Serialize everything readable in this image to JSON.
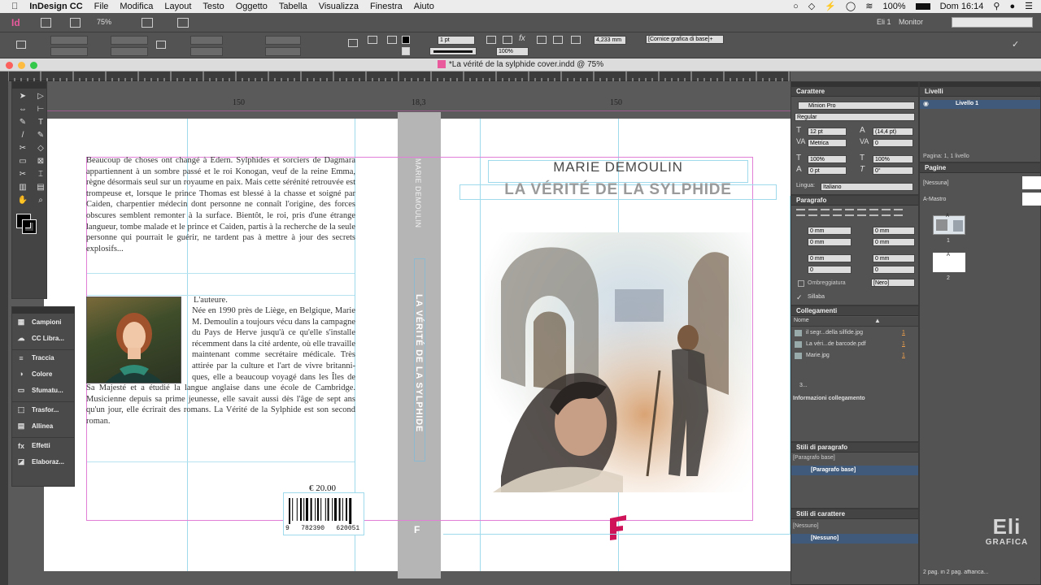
{
  "menubar": {
    "app_name": "InDesign CC",
    "items": [
      "File",
      "Modifica",
      "Layout",
      "Testo",
      "Oggetto",
      "Tabella",
      "Visualizza",
      "Finestra",
      "Aiuto"
    ],
    "battery": "100%",
    "clock": "Dom 16:14"
  },
  "appbar": {
    "logo": "Id",
    "zoom": "75%",
    "workspace": "Eli 1",
    "screen_mode": "Monitor"
  },
  "controlbar": {
    "stroke_weight": "1 pt",
    "opacity": "100%",
    "measure": "4,233 mm",
    "object_style": "[Cornice grafica di base]+"
  },
  "document": {
    "title": "*La vérité de la sylphide cover.indd @ 75%"
  },
  "ruler": {
    "dim_left": "150",
    "dim_spine": "18,3",
    "dim_right": "150"
  },
  "back_cover": {
    "blurb": "Beaucoup de choses ont changé à Edern. Sylphides et sorciers de Dagmara appartiennent à un sombre passé et le roi Konogan, veuf de la reine Emma, règne désormais seul sur un royaume en paix. Mais cette sérénité retrouvée est trompeuse et, lorsque le prince Thomas est blessé à la chasse et soigné par Caiden, charpentier médecin dont personne ne connaît l'origine, des forces obscures semblent remonter à la surface. Bientôt, le roi, pris d'une étrange langueur, tombe malade et le prince et Caiden, partis à la recherche de la seule personne qui pourrait le guérir, ne tardent pas à mettre à jour des secrets explosifs...",
    "author_heading": "L'auteure.",
    "author_bio": "Née en 1990 près de Liège, en Belgique, Marie M. Demoulin a toujours vécu dans la campagne du Pays de Herve jusqu'à ce qu'elle s'installe récemment dans la cité ardente, où elle travaille maintenant comme secrétaire médicale. Très attirée par la culture et l'art de vivre britanni-ques, elle a beaucoup voyagé dans les Îles de Sa Majesté et a étudié la langue anglaise dans une école de Cambridge. Musicienne depuis sa prime jeunesse, elle savait aussi dès l'âge de sept ans qu'un jour, elle écrirait des romans. La Vérité de la Sylphide est son second roman.",
    "price": "€ 20.00",
    "isbn": "9   782390   620051"
  },
  "spine": {
    "author": "MARIE DEMOULIN",
    "title": "LA VÉRITÉ DE LA SYLPHIDE"
  },
  "front_cover": {
    "author": "MARIE DEMOULIN",
    "title": "LA VÉRITÉ DE LA SYLPHIDE"
  },
  "tool_panel": {
    "items": [
      {
        "icon": "swatches-icon",
        "label": "Campioni"
      },
      {
        "icon": "cc-library-icon",
        "label": "CC Libra..."
      },
      {
        "icon": "stroke-icon",
        "label": "Traccia"
      },
      {
        "icon": "color-icon",
        "label": "Colore"
      },
      {
        "icon": "gradient-icon",
        "label": "Sfumatu..."
      },
      {
        "icon": "transform-icon",
        "label": "Trasfor..."
      },
      {
        "icon": "align-icon",
        "label": "Allinea"
      },
      {
        "icon": "effects-icon",
        "label": "Effetti"
      },
      {
        "icon": "pathfinder-icon",
        "label": "Elaboraz..."
      }
    ]
  },
  "character_panel": {
    "title": "Carattere",
    "font": "Minion Pro",
    "style": "Regular",
    "size": "12 pt",
    "leading": "(14,4 pt)",
    "kerning": "Metrica",
    "tracking": "0",
    "vscale": "100%",
    "hscale": "100%",
    "baseline": "0 pt",
    "skew": "0°",
    "language_label": "Lingua:",
    "language": "Italiano"
  },
  "paragraph_panel": {
    "title": "Paragrafo",
    "indent_left": "0 mm",
    "indent_right": "0 mm",
    "first_line": "0 mm",
    "last_line": "0 mm",
    "space_before": "0 mm",
    "space_after": "0 mm",
    "drop_lines": "0",
    "drop_chars": "0",
    "shading_label": "Ombreggiatura",
    "shading_color": "[Nero]",
    "hyphenate_label": "Sillaba"
  },
  "links_panel": {
    "title": "Collegamenti",
    "column_name": "Nome",
    "files": [
      {
        "name": "il segr...della silfide.jpg",
        "page": "1"
      },
      {
        "name": "La véri...de barcode.pdf",
        "page": "1"
      },
      {
        "name": "Marie.jpg",
        "page": "1"
      }
    ],
    "count": "3...",
    "info_label": "Informazioni collegamento"
  },
  "paragraph_styles": {
    "title": "Stili di paragrafo",
    "current": "[Paragrafo base]",
    "items": [
      "[Paragrafo base]"
    ]
  },
  "character_styles": {
    "title": "Stili di carattere",
    "current": "[Nessuno]",
    "items": [
      "[Nessuno]"
    ]
  },
  "layers_panel": {
    "title": "Livelli",
    "layer": "Livello 1",
    "footer": "Pagina: 1, 1 livello"
  },
  "pages_panel": {
    "title": "Pagine",
    "masters": [
      "[Nessuna]",
      "A-Mastro"
    ],
    "page_labels": [
      "1",
      "2"
    ],
    "master_letter": "A",
    "footer": "2 pag. in 2 pag. affianca..."
  },
  "watermark": {
    "line1": "Eli",
    "line2": "GRAFICA"
  }
}
